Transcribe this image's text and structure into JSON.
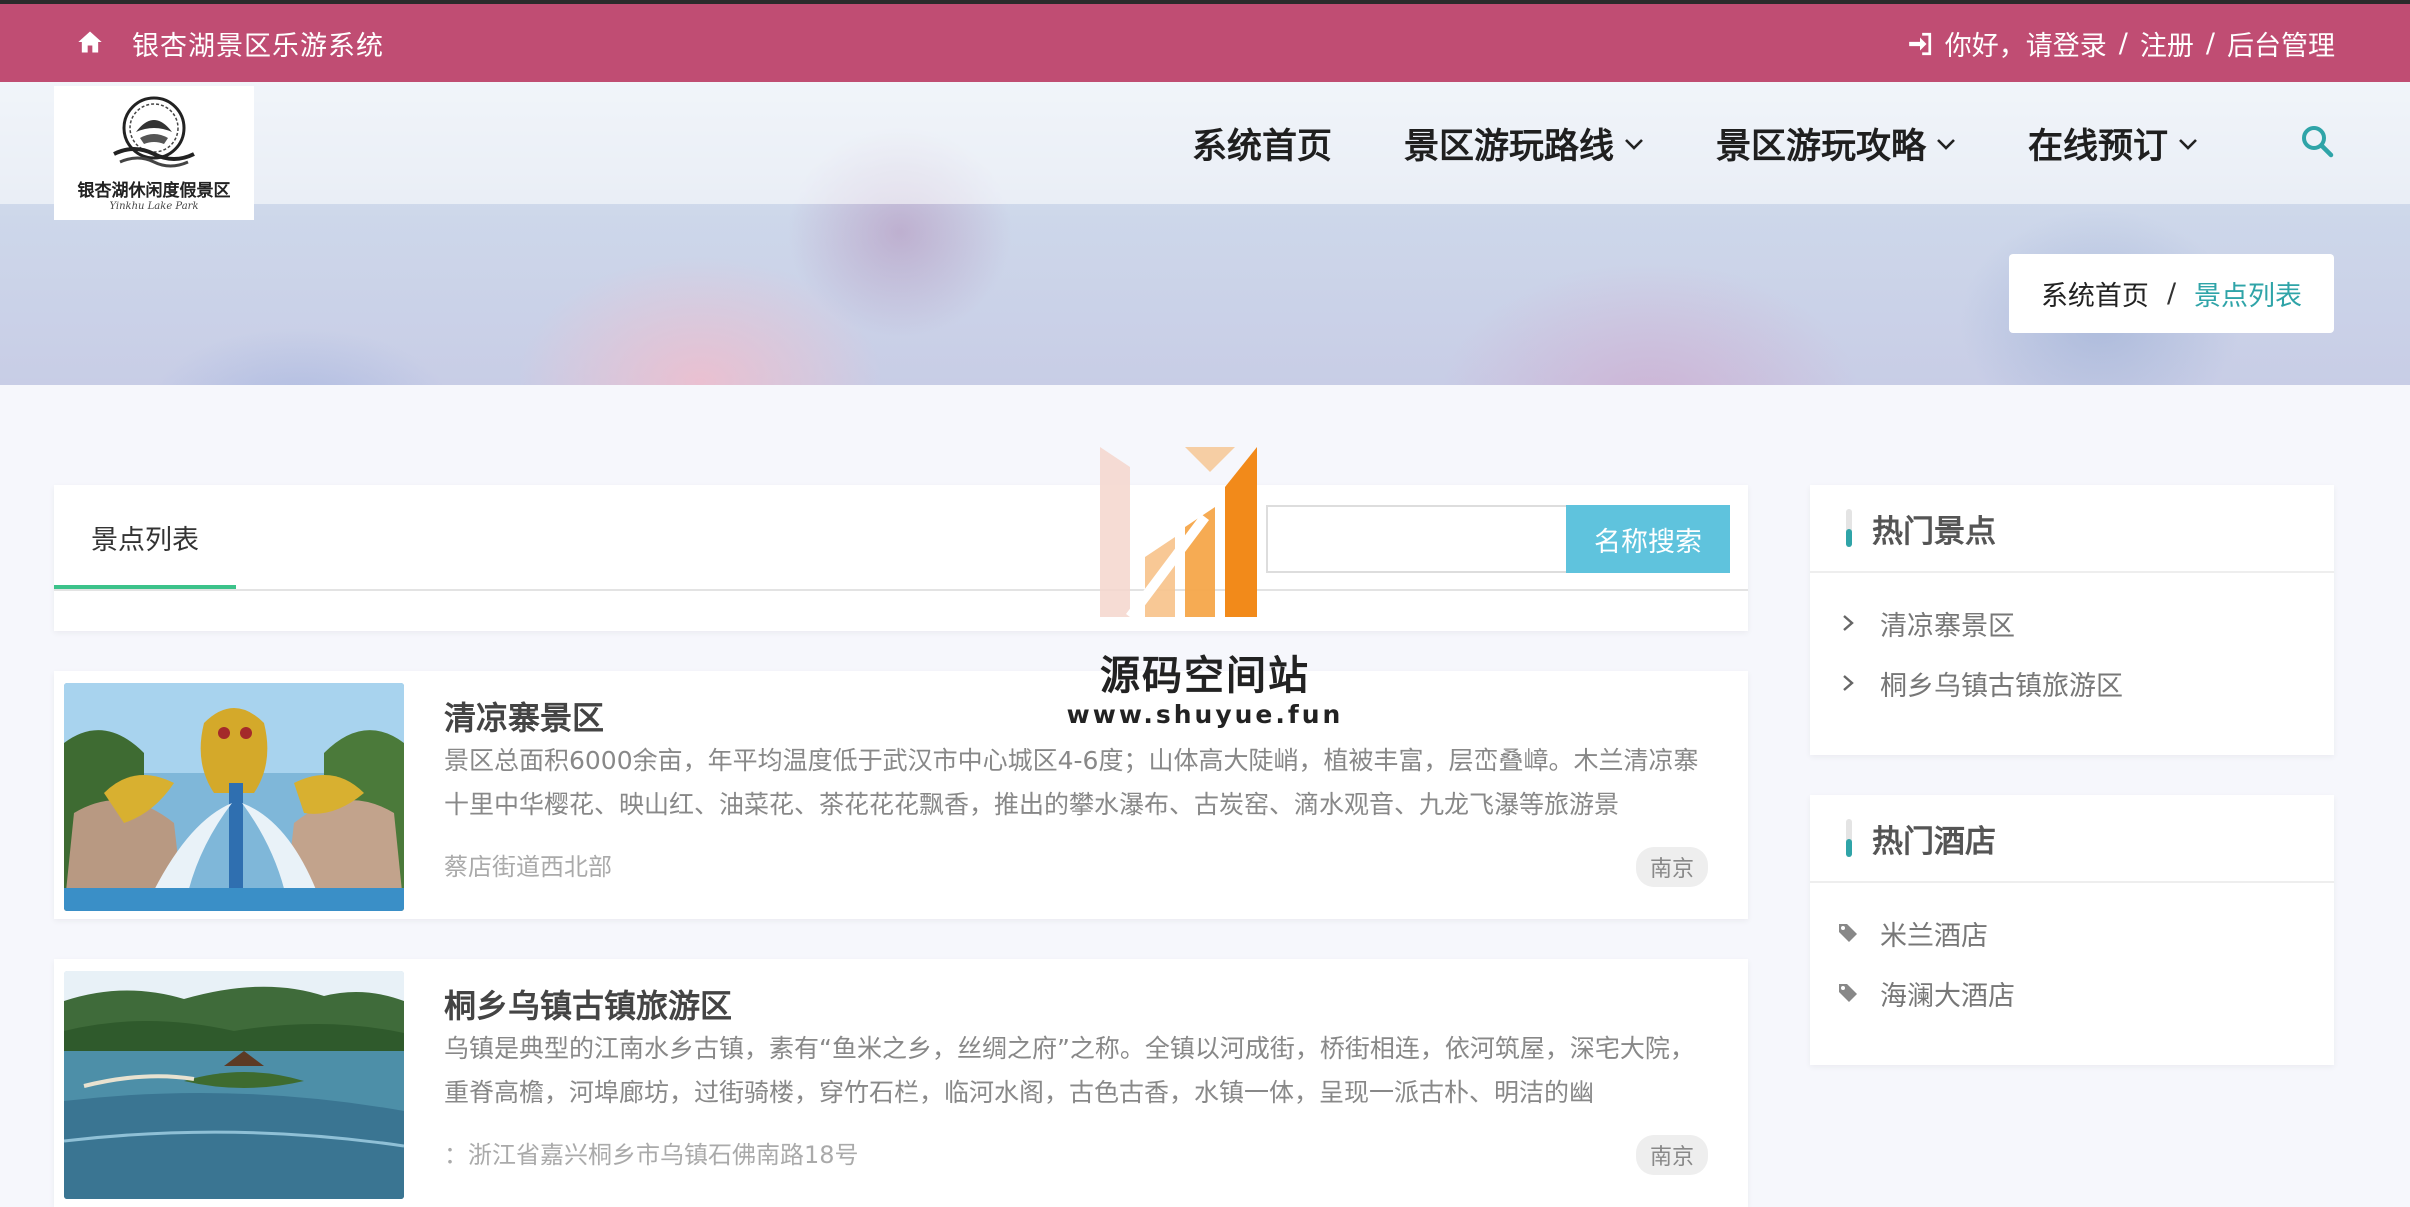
{
  "topbar": {
    "site_name": "银杏湖景区乐游系统",
    "greeting": "你好，请登录",
    "sep1": "/",
    "register": "注册",
    "sep2": "/",
    "admin": "后台管理"
  },
  "logo": {
    "title": "银杏湖休闲度假景区",
    "subtitle": "Yinkhu Lake Park"
  },
  "nav": {
    "items": [
      {
        "label": "系统首页",
        "dropdown": false
      },
      {
        "label": "景区游玩路线",
        "dropdown": true
      },
      {
        "label": "景区游玩攻略",
        "dropdown": true
      },
      {
        "label": "在线预订",
        "dropdown": true
      }
    ],
    "search_icon": "search-icon"
  },
  "breadcrumb": {
    "home": "系统首页",
    "separator": "/",
    "current": "景点列表"
  },
  "list_panel": {
    "tab_label": "景点列表",
    "search_placeholder": "",
    "search_button": "名称搜索"
  },
  "attractions": [
    {
      "title": "清凉寨景区",
      "description": "景区总面积6000余亩，年平均温度低于武汉市中心城区4-6度；山体高大陡峭，植被丰富，层峦叠嶂。木兰清凉寨十里中华樱花、映山红、油菜花、茶花花花飘香，推出的攀水瀑布、古炭窑、滴水观音、九龙飞瀑等旅游景",
      "address": "蔡店街道西北部",
      "city": "南京"
    },
    {
      "title": "桐乡乌镇古镇旅游区",
      "description": "乌镇是典型的江南水乡古镇，素有“鱼米之乡，丝绸之府”之称。全镇以河成街，桥街相连，依河筑屋，深宅大院，重脊高檐，河埠廊坊，过街骑楼，穿竹石栏，临河水阁，古色古香，水镇一体，呈现一派古朴、明洁的幽",
      "address": "：浙江省嘉兴桐乡市乌镇石佛南路18号",
      "city": "南京"
    }
  ],
  "sidebar": {
    "hot_spots": {
      "title": "热门景点",
      "items": [
        "清凉寨景区",
        "桐乡乌镇古镇旅游区"
      ]
    },
    "hot_hotels": {
      "title": "热门酒店",
      "items": [
        "米兰酒店",
        "海澜大酒店"
      ]
    }
  },
  "watermark": {
    "name": "源码空间站",
    "url": "www.shuyue.fun"
  },
  "colors": {
    "topbar": "#c04d73",
    "accent_teal": "#2fa4a8",
    "search_button": "#5fc3dd",
    "tab_underline": "#3cc28a"
  }
}
